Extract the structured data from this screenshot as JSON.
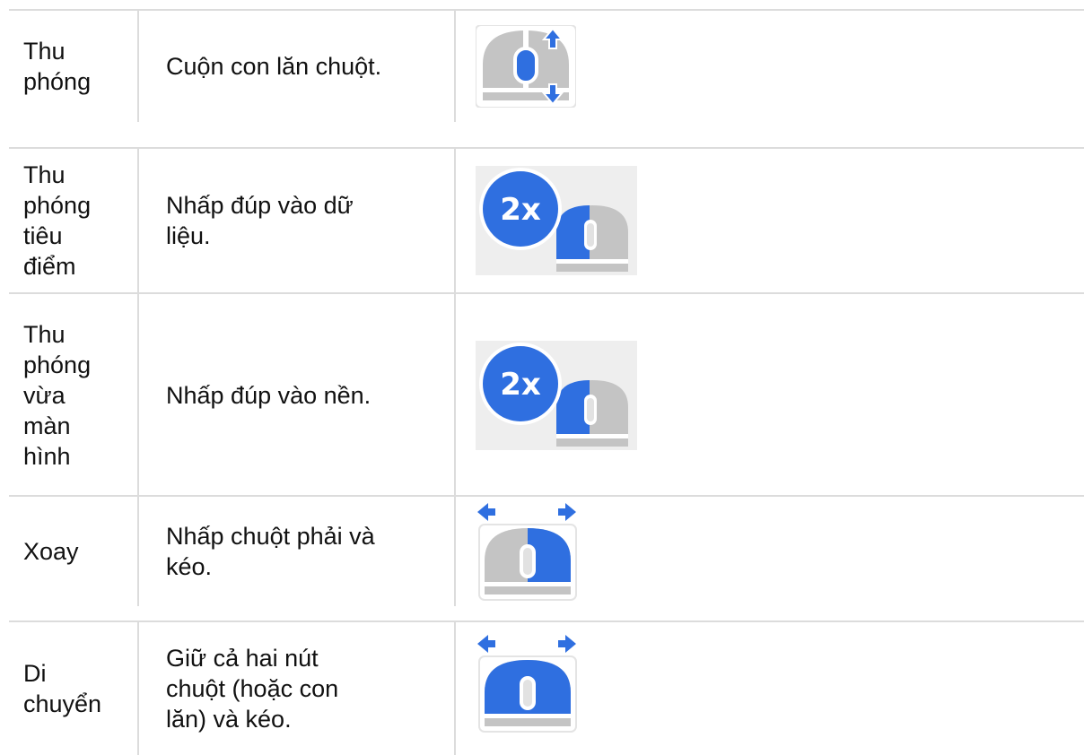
{
  "rows": [
    {
      "action": "Thu\nphóng",
      "description": "Cuộn con lăn chuột.",
      "icon": "mouse-scroll-wheel-icon"
    },
    {
      "action": "Thu\nphóng\ntiêu\nđiểm",
      "description": "Nhấp đúp vào dữ\nliệu.",
      "icon": "mouse-double-click-left-icon",
      "badge": "2x"
    },
    {
      "action": "Thu\nphóng\nvừa\nmàn\nhình",
      "description": "Nhấp đúp vào nền.",
      "icon": "mouse-double-click-left-icon",
      "badge": "2x"
    },
    {
      "action": "Xoay",
      "description": "Nhấp chuột phải và\nkéo.",
      "icon": "mouse-right-drag-icon"
    },
    {
      "action": "Di\nchuyển",
      "description": "Giữ cả hai nút\nchuột (hoặc con\nlăn) và kéo.",
      "icon": "mouse-both-buttons-drag-icon"
    }
  ],
  "colors": {
    "accent": "#2f6fe0",
    "mouse_gray": "#c4c4c4",
    "border": "#dcdcdc"
  }
}
